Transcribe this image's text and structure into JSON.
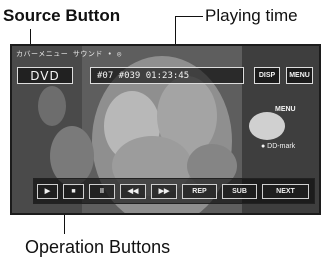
{
  "callouts": {
    "source_button": "Source Button",
    "playing_time": "Playing time",
    "operation_buttons": "Operation Buttons"
  },
  "screen": {
    "status_text": "カバーメニュー  サウンド • ◎",
    "source_label": "DVD",
    "playing_time": "#07 #039  01:23:45",
    "disp_label": "DISP",
    "menu_label": "MENU",
    "side_label_top": "MENU",
    "side_label_bottom": "● DD-mark"
  },
  "operation_buttons": [
    {
      "label": "▶",
      "icon": "play-icon"
    },
    {
      "label": "■",
      "icon": "stop-icon"
    },
    {
      "label": "II",
      "icon": "pause-icon"
    },
    {
      "label": "◀◀",
      "icon": "rewind-icon"
    },
    {
      "label": "▶▶",
      "icon": "fast-forward-icon"
    },
    {
      "label": "REP",
      "icon": "repeat-icon"
    },
    {
      "label": "SUB",
      "icon": "subtitle-icon"
    },
    {
      "label": "NEXT",
      "icon": "next-icon"
    }
  ]
}
